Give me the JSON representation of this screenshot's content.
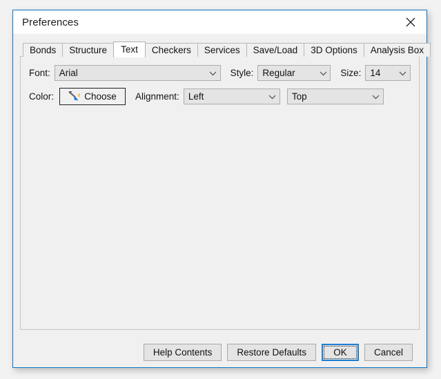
{
  "window": {
    "title": "Preferences",
    "close_icon": "close-icon",
    "border_color": "#0a74c8"
  },
  "tabs": [
    {
      "label": "Bonds",
      "selected": false
    },
    {
      "label": "Structure",
      "selected": false
    },
    {
      "label": "Text",
      "selected": true
    },
    {
      "label": "Checkers",
      "selected": false
    },
    {
      "label": "Services",
      "selected": false
    },
    {
      "label": "Save/Load",
      "selected": false
    },
    {
      "label": "3D Options",
      "selected": false
    },
    {
      "label": "Analysis Box",
      "selected": false
    }
  ],
  "text_tab": {
    "font": {
      "label": "Font:",
      "value": "Arial",
      "chevron_icon": "chevron-down-icon"
    },
    "style": {
      "label": "Style:",
      "value": "Regular",
      "chevron_icon": "chevron-down-icon"
    },
    "size": {
      "label": "Size:",
      "value": "14",
      "chevron_icon": "chevron-down-icon"
    },
    "color": {
      "label": "Color:",
      "button_label": "Choose",
      "button_icon": "paintbrush-icon",
      "icon_accent_color": "#1f6fd0"
    },
    "alignment": {
      "label": "Alignment:",
      "value": "Left",
      "chevron_icon": "chevron-down-icon"
    },
    "vertical_alignment": {
      "value": "Top",
      "chevron_icon": "chevron-down-icon"
    }
  },
  "buttons": {
    "help": "Help Contents",
    "restore": "Restore Defaults",
    "ok": "OK",
    "cancel": "Cancel",
    "default_focus_color": "#1a7fd4"
  }
}
